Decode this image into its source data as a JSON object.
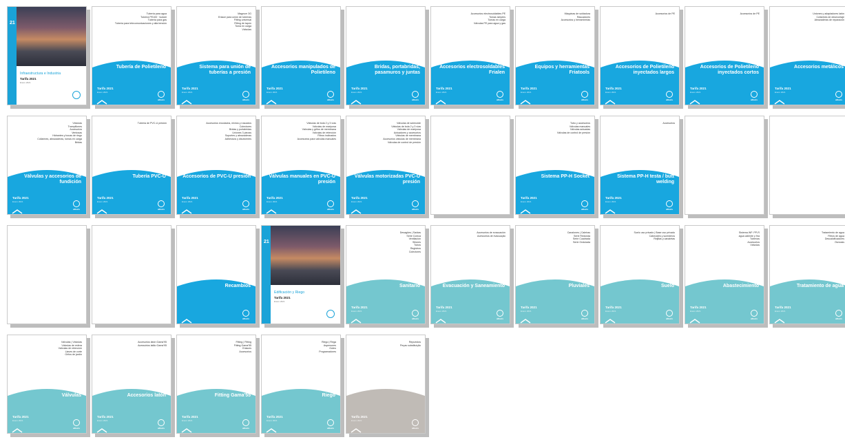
{
  "colors": {
    "blue": "#18a7df",
    "teal": "#74c7cf",
    "grey": "#c0bbb6",
    "photo_side": "#1aa3d8"
  },
  "catalogue": [
    {
      "kind": "photo",
      "num": "21",
      "title": "Infraestructura e Industria",
      "tarifa": "Tarifa 2021",
      "date": "Enero 2021",
      "brand": "alliaxis"
    },
    {
      "color": "blue",
      "toc": [
        "Tubería para agua",
        "Tubería PE100 · Isotubi",
        "Tubería para gas",
        "Tubería para telecomunicaciones y alta tensión"
      ],
      "title": "Tubería de Polietileno",
      "tarifa": "Tarifa 2021",
      "date": "Enero 2021",
      "brand": "alliaxis"
    },
    {
      "color": "blue",
      "toc": [
        "Magnum 3G",
        "Enlace para unión de tuberías",
        "Fitting universal",
        "Fitting de tapón",
        "Toma en carga",
        "Válvulas"
      ],
      "title": "Sistema para unión de tuberías a presión",
      "tarifa": "Tarifa 2021",
      "date": "Enero 2021",
      "brand": "alliaxis"
    },
    {
      "color": "blue",
      "toc": [],
      "title": "Accesorios manipulados de Polietileno",
      "tarifa": "Tarifa 2021",
      "date": "Enero 2021",
      "brand": "alliaxis"
    },
    {
      "color": "blue",
      "toc": [],
      "title": "Bridas, portabridas, pasamuros y juntas",
      "tarifa": "Tarifa 2021",
      "date": "Enero 2021",
      "brand": "alliaxis"
    },
    {
      "color": "blue",
      "toc": [
        "Accesorios electrosoldables PE",
        "Tomas simples",
        "Tomas en carga",
        "Válvulas PE para agua y gas"
      ],
      "title": "Accesorios electrosoldables Frialen",
      "tarifa": "Tarifa 2021",
      "date": "Enero 2021",
      "brand": "alliaxis"
    },
    {
      "color": "blue",
      "toc": [
        "Máquinas de soldadura",
        "Rascadores",
        "Accesorios y herramientas"
      ],
      "title": "Equipos y herramientas Friatools",
      "tarifa": "Tarifa 2021",
      "date": "Enero 2021",
      "brand": "alliaxis"
    },
    {
      "color": "blue",
      "toc": [
        "Accesorios de PE"
      ],
      "title": "Accesorios de Polietileno inyectados largos",
      "tarifa": "Tarifa 2021",
      "date": "Enero 2021",
      "brand": "alliaxis"
    },
    {
      "color": "blue",
      "toc": [
        "Accesorios de PE"
      ],
      "title": "Accesorios de Polietileno inyectados cortos",
      "tarifa": "Tarifa 2021",
      "date": "Enero 2021",
      "brand": "alliaxis"
    },
    {
      "color": "blue",
      "toc": [
        "Uniones y adaptadores latón",
        "Collarines de desmontaje",
        "Abrazaderas de reparación"
      ],
      "title": "Accesorios metálicos",
      "tarifa": "Tarifa 2021",
      "date": "Enero 2021",
      "brand": "alliaxis"
    },
    {
      "color": "blue",
      "toc": [
        "Válvulas",
        "Trampillones",
        "Accesorios",
        "Ventosas",
        "Hidrantes y bocas de riego",
        "Collarines, abrazaderas, tomas en carga",
        "Bridas"
      ],
      "title": "Válvulas y accesorios de fundición",
      "tarifa": "Tarifa 2021",
      "date": "Enero 2021",
      "brand": "alliaxis"
    },
    {
      "color": "blue",
      "toc": [
        "Tubería de PVC-U presión"
      ],
      "title": "Tubería PVC-U",
      "tarifa": "Tarifa 2021",
      "date": "Enero 2021",
      "brand": "alliaxis"
    },
    {
      "color": "blue",
      "toc": [
        "Accesorios encolados, mixtos y roscados",
        "Colectores",
        "Bridas y portabridas",
        "Uniones 3 piezas",
        "Soportes y abrazaderas",
        "Adhesivos y disolventes"
      ],
      "title": "Accesorios de PVC-U presión",
      "tarifa": "Tarifa 2021",
      "date": "Enero 2021",
      "brand": "alliaxis"
    },
    {
      "color": "blue",
      "toc": [
        "Válvulas de bola 2 y 3 vías",
        "Válvulas de mariposa",
        "Válvulas y grifos de membrana",
        "Válvulas de retención",
        "Filtros inclinados",
        "Accesorios para válvulas manuales"
      ],
      "title": "Válvulas manuales en PVC-U presión",
      "tarifa": "Tarifa 2021",
      "date": "Enero 2021",
      "brand": "alliaxis"
    },
    {
      "color": "blue",
      "toc": [
        "Válvulas de solenoide",
        "Válvulas de bola 2 y 3 vías",
        "Válvulas de mariposa",
        "Actuadores y accesorios",
        "Válvulas de membrana",
        "Accesorios válvulas de membrana",
        "Válvulas de control de presión"
      ],
      "title": "Válvulas motorizadas PVC-U presión",
      "tarifa": "Tarifa 2021",
      "date": "Enero 2021",
      "brand": "alliaxis"
    },
    {
      "kind": "blank"
    },
    {
      "color": "blue",
      "toc": [
        "Tubo y accesorios",
        "Válvulas manuales",
        "Válvulas actuadas",
        "Válvulas de control de presión"
      ],
      "title": "Sistema PP-H Socket",
      "tarifa": "Tarifa 2021",
      "date": "Enero 2021",
      "brand": "alliaxis"
    },
    {
      "color": "blue",
      "toc": [
        "Accesorios"
      ],
      "title": "Sistema PP-H testa / butt welding",
      "tarifa": "Tarifa 2021",
      "date": "Enero 2021",
      "brand": "alliaxis"
    },
    {
      "kind": "blank"
    },
    {
      "kind": "blank"
    },
    {
      "kind": "blank"
    },
    {
      "kind": "blank"
    },
    {
      "color": "blue",
      "toc": [],
      "title": "Recambios",
      "tarifa": "",
      "date": "",
      "brand": "alliaxis"
    },
    {
      "kind": "photo",
      "num": "21",
      "title": "Edificación y Riego",
      "tarifa": "Tarifa 2021",
      "date": "Enero 2021",
      "brand": "alliaxis"
    },
    {
      "color": "teal",
      "toc": [
        "Desagües | Saídas",
        "Serie Conica",
        "Ventilación",
        "Sifones",
        "Tubos",
        "Registros",
        "Colectores"
      ],
      "title": "Sanitario",
      "tarifa": "Tarifa 2021",
      "date": "Enero 2021",
      "brand": "alliaxis"
    },
    {
      "color": "teal",
      "toc": [
        "Accesorios de evacuación",
        "Acessórios de evacuação"
      ],
      "title": "Evacuación y Saneamiento",
      "tarifa": "Tarifa 2021",
      "date": "Enero 2021",
      "brand": "alliaxis"
    },
    {
      "color": "teal",
      "toc": [
        "Canalones | Caleiras",
        "Serie Redonda",
        "Serie Cuadrada",
        "Serie Ondulada"
      ],
      "title": "Pluviales",
      "tarifa": "Tarifa 2021",
      "date": "Enero 2021",
      "brand": "alliaxis"
    },
    {
      "color": "teal",
      "toc": [
        "Suelo uso privado | Base uso privado",
        "Cabezales y sumideros",
        "Rejillas y canaletas"
      ],
      "title": "Suelo",
      "tarifa": "Tarifa 2021",
      "date": "Enero 2021",
      "brand": "alliaxis"
    },
    {
      "color": "teal",
      "toc": [
        "Sistema WF: PP-R",
        "agua caliente y fría",
        "Tuberías",
        "Accesorios",
        "Válvulas"
      ],
      "title": "Abastecimiento",
      "tarifa": "Tarifa 2021",
      "date": "Enero 2021",
      "brand": "alliaxis"
    },
    {
      "color": "teal",
      "toc": [
        "Tratamiento de agua",
        "Filtros de agua",
        "Descalcificadores",
        "Ósmosis"
      ],
      "title": "Tratamiento de agua",
      "tarifa": "Tarifa 2021",
      "date": "Enero 2021",
      "brand": "alliaxis"
    },
    {
      "color": "teal",
      "toc": [
        "Válvulas | Válvulas",
        "Válvulas de esfera",
        "Válvulas de retención",
        "Llaves de corte",
        "Grifos de jardín"
      ],
      "title": "Válvulas",
      "tarifa": "Tarifa 2021",
      "date": "Enero 2021",
      "brand": "alliaxis"
    },
    {
      "color": "teal",
      "toc": [
        "Accesorios latón Gama'95",
        "Acessórios latão Gama'95"
      ],
      "title": "Accesorios latón",
      "tarifa": "Tarifa 2021",
      "date": "Enero 2021",
      "brand": "alliaxis"
    },
    {
      "color": "teal",
      "toc": [
        "Fitting | Fitting",
        "Fitting Gama'55",
        "Enlaces",
        "Accesorios"
      ],
      "title": "Fitting Gama'55",
      "tarifa": "Tarifa 2021",
      "date": "Enero 2021",
      "brand": "alliaxis"
    },
    {
      "color": "teal",
      "toc": [
        "Riego | Rega",
        "Aspersores",
        "Goteo",
        "Programadores"
      ],
      "title": "Riego",
      "tarifa": "Tarifa 2021",
      "date": "Enero 2021",
      "brand": "alliaxis"
    },
    {
      "color": "grey",
      "toc": [
        "Repuestos",
        "Peças substituição"
      ],
      "title": "",
      "tarifa": "Tarifa 2021",
      "date": "Enero 2021",
      "brand": "alliaxis"
    }
  ]
}
